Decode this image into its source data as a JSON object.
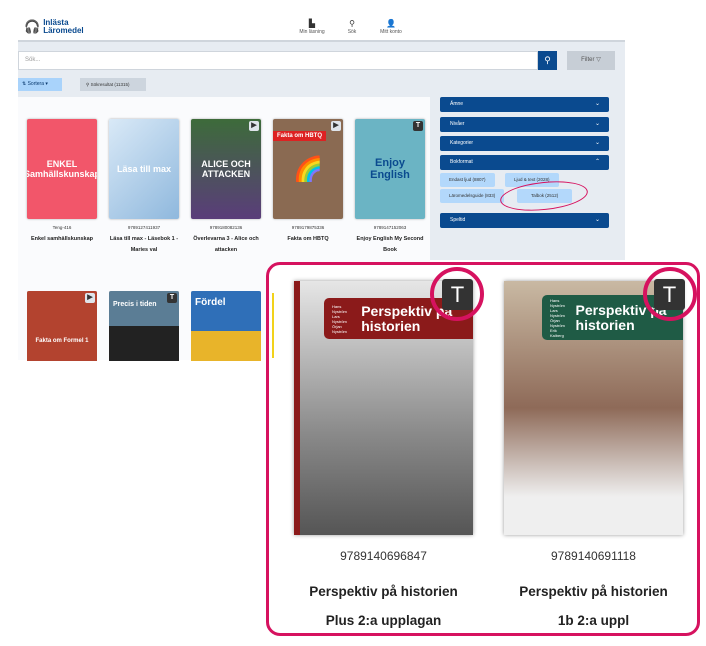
{
  "header": {
    "logo_line1": "Inlästa",
    "logo_line2": "Läromedel",
    "nav": [
      {
        "label": "Min läsning",
        "icon": "books-icon"
      },
      {
        "label": "Sök",
        "icon": "search-icon"
      },
      {
        "label": "Mitt konto",
        "icon": "user-icon"
      }
    ]
  },
  "search": {
    "placeholder": "Sök...",
    "filter_label": "Filter"
  },
  "toolbar": {
    "sort_label": "Sortera",
    "results_label": "Sökresultat (11315)"
  },
  "books": [
    {
      "isbn": "Teng-416",
      "title": "Enkel samhällskunskap",
      "cover_text": "ENKEL Samhällskunskap",
      "color": "#f2566a"
    },
    {
      "isbn": "9789127411937",
      "title": "Läsa till max - Läsebok 1 - Maries val",
      "cover_text": "Läsa till max",
      "color": "#a9cbe8"
    },
    {
      "isbn": "9789180082136",
      "title": "Överlevarna 3 - Alice och attacken",
      "cover_text": "ALICE OCH ATTACKEN",
      "color": "#5a3d7a",
      "badge": "audio"
    },
    {
      "isbn": "9789179875336",
      "title": "Fakta om HBTQ",
      "cover_text": "Fakta om HBTQ",
      "color": "#8a6a52",
      "badge": "audio"
    },
    {
      "isbn": "9789147152063",
      "title": "Enjoy English My Second Book",
      "cover_text": "Enjoy English",
      "color": "#6bb4c4",
      "badge": "T"
    }
  ],
  "books_row2": [
    {
      "cover_text": "Fakta om Formel 1",
      "color": "#b3432f",
      "badge": "audio"
    },
    {
      "cover_text": "Precis i tiden",
      "color": "#5b7d95",
      "badge": "T"
    },
    {
      "cover_text": "Fördel",
      "color": "#2f6fb8"
    }
  ],
  "filters": {
    "sections": [
      "Ämne",
      "Nivåer",
      "Kategorier",
      "Bokformat",
      "Speltid"
    ],
    "chips": [
      "Endast ljud (8807)",
      "Ljud & text (2028)",
      "Läromedelsguide (833)",
      "Talbok (2512)"
    ]
  },
  "highlight": {
    "badge_letter": "T",
    "books": [
      {
        "isbn": "9789140696847",
        "title": "Perspektiv på historien",
        "subtitle": "Plus 2:a upplagan",
        "cover_title": "Perspektiv på historien",
        "authors": "Hans Nyström Lars Nyström Örjan Nyström",
        "band": "#8b1a1a"
      },
      {
        "isbn": "9789140691118",
        "title": "Perspektiv på historien",
        "subtitle": "1b 2:a uppl",
        "cover_title": "Perspektiv på historien",
        "authors": "Hans Nyström Lars Nyström Örjan Nyström Erik Kalberg",
        "band": "#1f5b45"
      }
    ]
  },
  "colors": {
    "primary": "#0a4a8f",
    "accent_highlight": "#d6125f"
  }
}
